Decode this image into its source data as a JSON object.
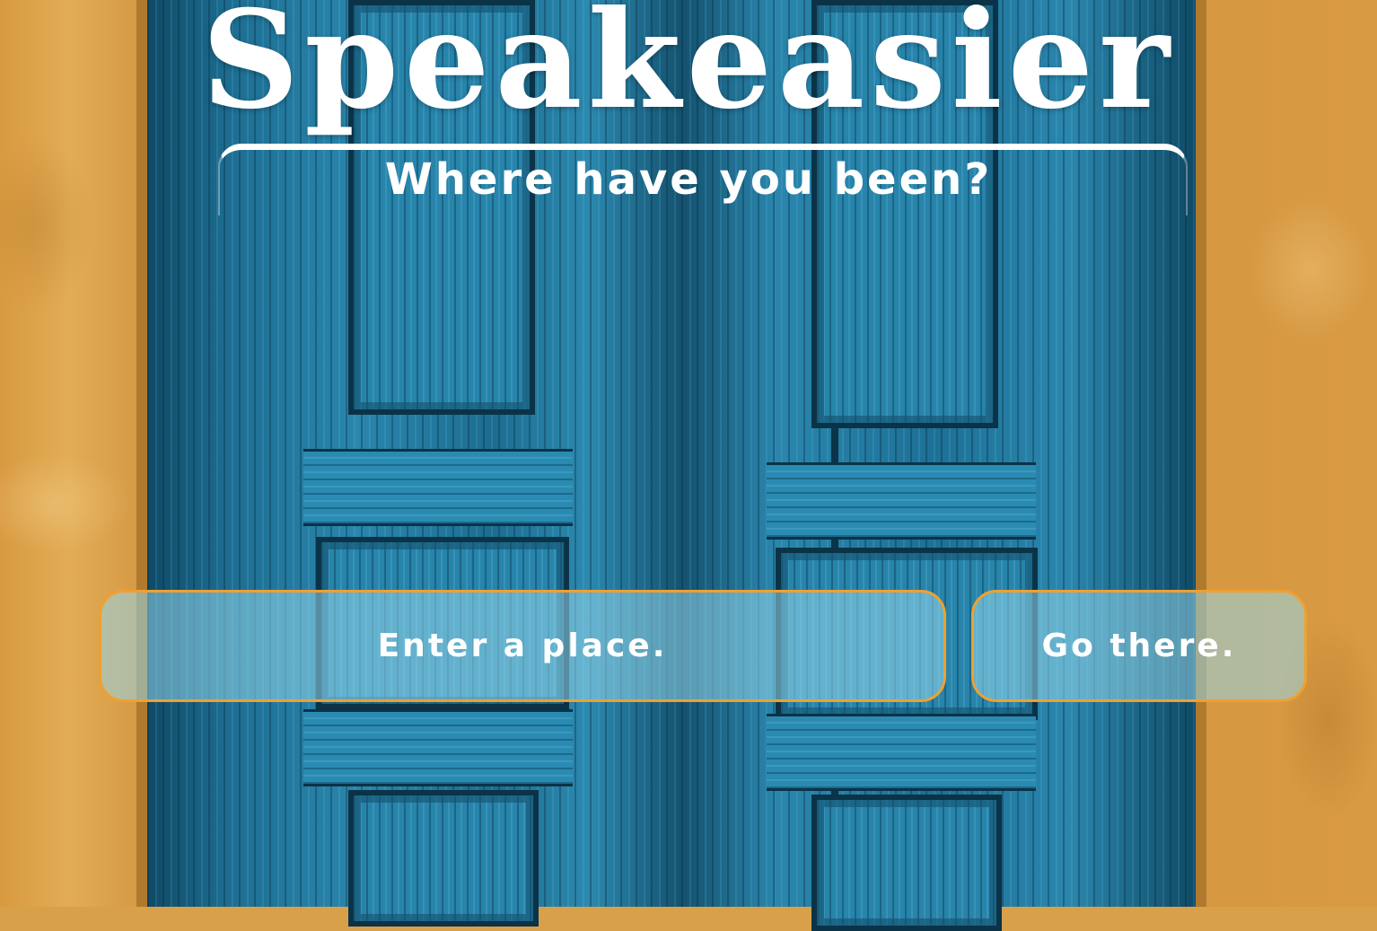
{
  "header": {
    "title": "Speakeasier",
    "subtitle": "Where have you been?"
  },
  "search": {
    "placeholder": "Enter a place.",
    "value": ""
  },
  "actions": {
    "go_label": "Go there."
  },
  "colors": {
    "accent_border": "#f0a030",
    "text": "#ffffff",
    "door_blue": "#2784ab",
    "wall_ochre": "#d89a42"
  }
}
